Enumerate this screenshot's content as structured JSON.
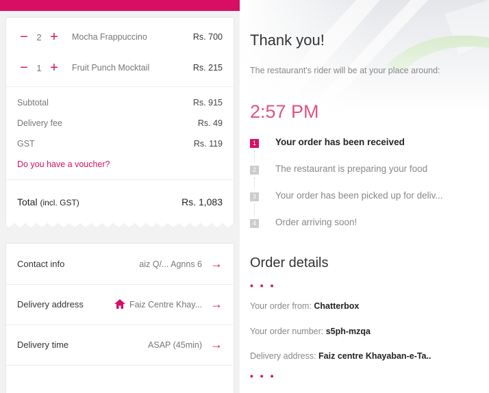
{
  "cart": {
    "items": [
      {
        "qty": "2",
        "name": "Mocha Frappuccino",
        "price": "Rs. 700"
      },
      {
        "qty": "1",
        "name": "Fruit Punch Mocktail",
        "price": "Rs. 215"
      }
    ],
    "minus_glyph": "−",
    "plus_glyph": "+",
    "subtotal_label": "Subtotal",
    "subtotal": "Rs. 915",
    "delivery_fee_label": "Delivery fee",
    "delivery_fee": "Rs. 49",
    "gst_label": "GST",
    "gst": "Rs. 119",
    "voucher_link": "Do you have a voucher?",
    "total_label": "Total",
    "total_note": "(incl. GST)",
    "total": "Rs. 1,083"
  },
  "info": {
    "contact_label": "Contact info",
    "contact_value": "aiz Q/...  A⁠gnns  6",
    "address_label": "Delivery address",
    "address_value": "Faiz Centre Khay...",
    "time_label": "Delivery time",
    "time_value": "ASAP (45min)",
    "arrow": "→"
  },
  "confirmation": {
    "title": "Thank you!",
    "subtitle": "The restaurant's rider will be at your place around:",
    "eta": "2:57 PM",
    "steps": [
      {
        "num": "1",
        "text": "Your order has been received"
      },
      {
        "num": "2",
        "text": "The restaurant is preparing your food"
      },
      {
        "num": "3",
        "text": "Your order has been picked up for deliv..."
      },
      {
        "num": "4",
        "text": "Order arriving soon!"
      }
    ]
  },
  "order_details": {
    "title": "Order details",
    "dots": "• • •",
    "from_label": "Your order from: ",
    "from_value": "Chatterbox",
    "number_label": "Your order number: ",
    "number_value": "s5ph-mzqa",
    "address_label": "Delivery address: ",
    "address_value": "Faiz centre Khayaban-e-Ta.."
  },
  "colors": {
    "brand": "#d70f64",
    "eta": "#e0527f"
  }
}
